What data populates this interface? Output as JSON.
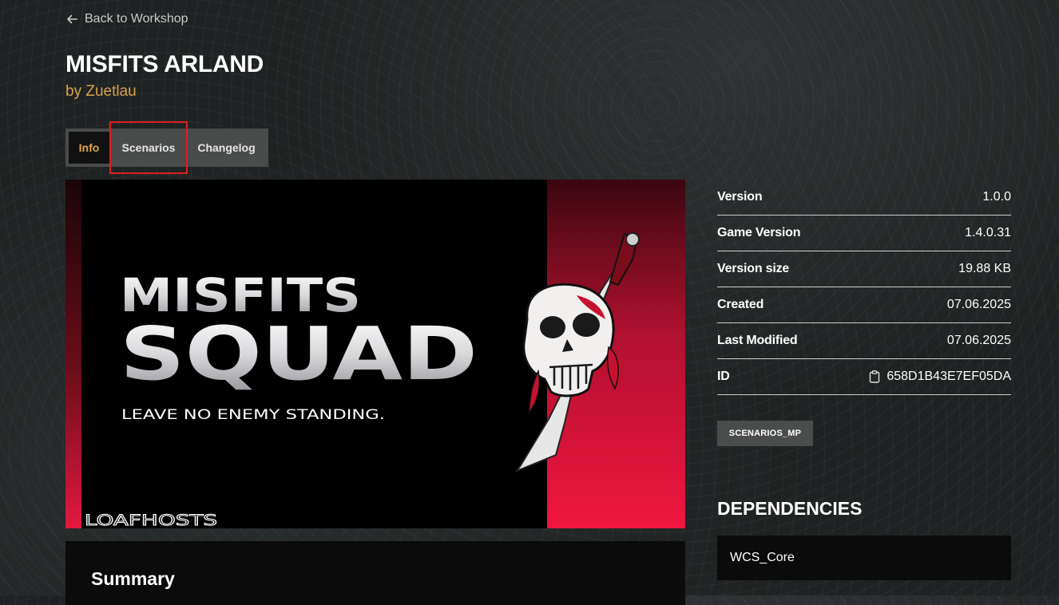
{
  "nav": {
    "back_label": "Back to Workshop",
    "back_icon": "arrow-left-icon"
  },
  "mod": {
    "title": "MISFITS ARLAND",
    "author": "by Zuetlau"
  },
  "tabs": [
    {
      "label": "Info",
      "active": true
    },
    {
      "label": "Scenarios",
      "highlighted": true
    },
    {
      "label": "Changelog"
    }
  ],
  "banner": {
    "line1": "MISFITS",
    "line2": "SQUAD",
    "tagline": "LEAVE NO ENEMY STANDING.",
    "sponsor": "LOAFHOSTS"
  },
  "summary": {
    "heading": "Summary"
  },
  "meta": [
    {
      "label": "Version",
      "value": "1.0.0"
    },
    {
      "label": "Game Version",
      "value": "1.4.0.31"
    },
    {
      "label": "Version size",
      "value": "19.88 KB"
    },
    {
      "label": "Created",
      "value": "07.06.2025"
    },
    {
      "label": "Last Modified",
      "value": "07.06.2025"
    },
    {
      "label": "ID",
      "value": "658D1B43E7EF05DA",
      "icon": "clipboard-icon"
    }
  ],
  "tag": "SCENARIOS_MP",
  "dependencies": {
    "heading": "DEPENDENCIES",
    "items": [
      "WCS_Core"
    ]
  },
  "colors": {
    "accent": "#d9a34a",
    "highlight_border": "#e01e1e",
    "banner_red": "#f0163f"
  }
}
